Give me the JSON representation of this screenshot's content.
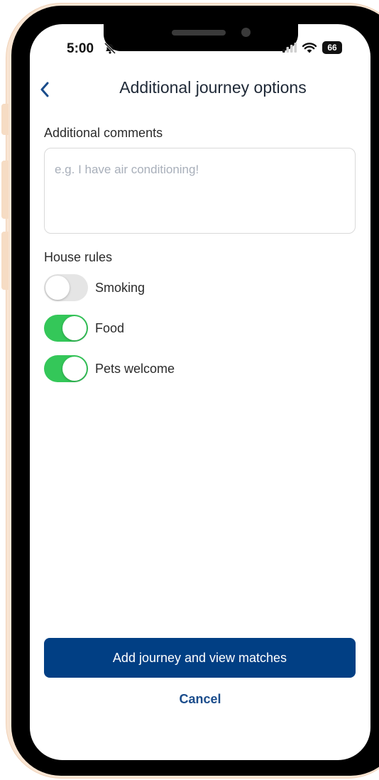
{
  "status_bar": {
    "time": "5:00",
    "battery": "66",
    "icons": [
      "bell-slash-icon",
      "signal-icon",
      "wifi-icon",
      "battery-icon"
    ]
  },
  "header": {
    "title": "Additional journey options",
    "back_icon": "chevron-left-icon"
  },
  "comments": {
    "label": "Additional comments",
    "placeholder": "e.g. I have air conditioning!",
    "value": ""
  },
  "house_rules": {
    "label": "House rules",
    "rules": [
      {
        "label": "Smoking",
        "on": false
      },
      {
        "label": "Food",
        "on": true
      },
      {
        "label": "Pets welcome",
        "on": true
      }
    ]
  },
  "actions": {
    "primary_label": "Add journey and view matches",
    "cancel_label": "Cancel"
  },
  "colors": {
    "primary": "#013f84",
    "toggle_on": "#34c759",
    "toggle_off": "#e5e5e5",
    "frame": "#f9e5d3"
  }
}
